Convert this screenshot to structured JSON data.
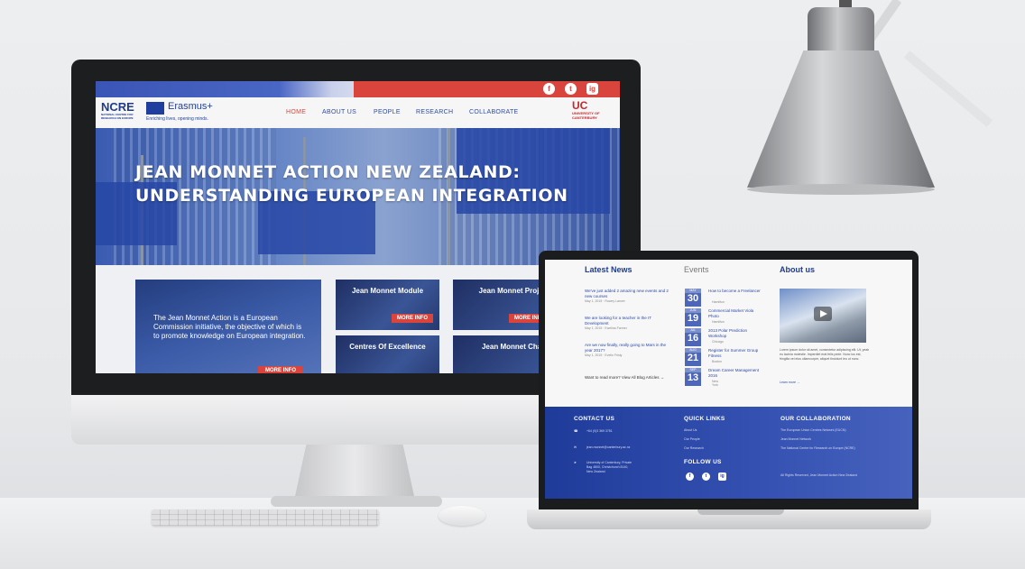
{
  "site": {
    "social": [
      "f",
      "t",
      "ig"
    ],
    "logo": {
      "ncre": "NCRE",
      "ncre_sub": "NATIONAL CENTRE FOR RESEARCH ON EUROPE",
      "erasmus": "Erasmus+",
      "erasmus_sub": "Enriching lives, opening minds.",
      "uc": "UC",
      "uc_sub": "UNIVERSITY OF CANTERBURY"
    },
    "nav": [
      "HOME",
      "ABOUT US",
      "PEOPLE",
      "RESEARCH",
      "COLLABORATE"
    ],
    "hero_title_1": "JEAN MONNET ACTION NEW ZEALAND:",
    "hero_title_2": "UNDERSTANDING EUROPEAN INTEGRATION",
    "intro": "The Jean Monnet Action is a European Commission initiative, the objective of which is to promote knowledge on European integration.",
    "more_info": "MORE INFO",
    "cards": [
      "Jean Monnet Module",
      "Jean Monnet Projects",
      "Centres Of Excellence",
      "Jean Monnet Chairs"
    ]
  },
  "laptop": {
    "news_heading": "Latest News",
    "events_heading": "Events",
    "about_heading": "About us",
    "news": [
      {
        "title": "We've just added 2 amazing new events and 2 new courses",
        "meta": "May 1, 2015 · Rowey Lanver"
      },
      {
        "title": "We are looking for a teacher in the IT Development",
        "meta": "May 1, 2015 · Ewelina Farmer"
      },
      {
        "title": "Are we now finally, really going to Mars in the year 2017?",
        "meta": "May 1, 2015 · Evelin Fristy"
      }
    ],
    "want_more": "Want to read more? View All Blog Articles →",
    "events": [
      {
        "day": "30",
        "month": "MAY",
        "title": "How to become a Freelancer",
        "loc": "Hamilton"
      },
      {
        "day": "19",
        "month": "JUN",
        "title": "Commercial Market Viola Photo",
        "loc": "Hamilton"
      },
      {
        "day": "16",
        "month": "JUL",
        "title": "2013 Polar Prediction Workshop",
        "loc": "Chicago"
      },
      {
        "day": "21",
        "month": "AUG",
        "title": "Register for Summer Group Fitness",
        "loc": "Boston"
      },
      {
        "day": "13",
        "month": "SEP",
        "title": "Dream Career Management 2016",
        "loc": "New York"
      }
    ],
    "about_text": "Lorem ipsum dolor sit amet, consectetur adipiscing elit. Ut, yeah eu lacinia molestie. Imperdiet erat felis pede. Nunc ius est, fringilla vel eius ullamcorper, aliquet tincidunt leo ut nunc.",
    "learn_more": "Learn more →",
    "footer": {
      "contact_heading": "CONTACT US",
      "phone": "+64 (0)3 369 3781",
      "email": "jean.monnet@canterbury.ac.nz",
      "address": "University of Canterbury, Private Bag 4800, Christchurch 8140, New Zealand",
      "quick_heading": "QUICK LINKS",
      "quick": [
        "About Us",
        "Our People",
        "Our Research"
      ],
      "follow_heading": "FOLLOW US",
      "collab_heading": "OUR COLLABORATION",
      "collab": [
        "The European Union Centres Network (EUCN)",
        "Jean Monnet Network",
        "The National Centre for Research on Europe (NCRE)"
      ],
      "rights": "All Rights Reserved, Jean Monnet Action New Zealand"
    }
  }
}
